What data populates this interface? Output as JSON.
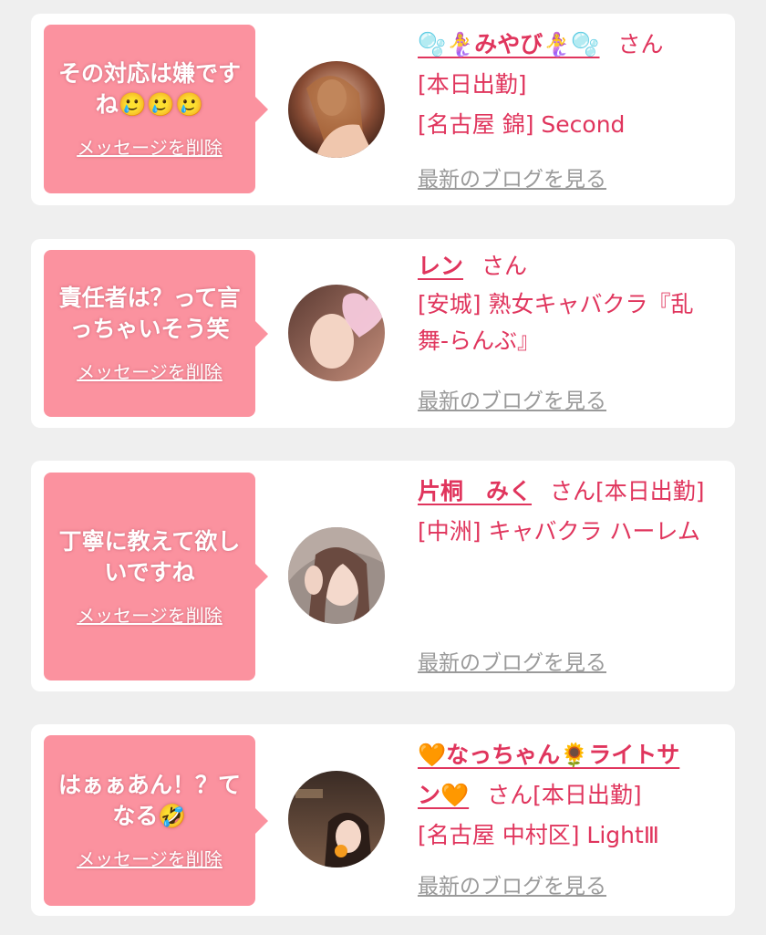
{
  "colors": {
    "page_background": "#efefef",
    "card_background": "#ffffff",
    "bubble": "#fb929f",
    "accent_text": "#e0355d",
    "link_gray": "#9a9a9a"
  },
  "cards": [
    {
      "message_lines": [
        "その対応は嫌です",
        "ね🥲🥲🥲"
      ],
      "delete_label": "メッセージを削除",
      "name_line1": "🫧🧜‍♀️みやび🧜‍♀️🫧",
      "name_line2": "",
      "honorific": "さん",
      "status": "[本日出勤]",
      "shop": "[名古屋 錦] Second",
      "blog_label": "最新のブログを見る",
      "avatar_icon": "profile-photo"
    },
    {
      "message_lines": [
        "責任者は？って言",
        "っちゃいそう笑"
      ],
      "delete_label": "メッセージを削除",
      "name_line1": "レン",
      "name_line2": "",
      "honorific": "さん",
      "status": "",
      "shop": "[安城] 熟女キャバクラ『乱舞-らんぶ』",
      "blog_label": "最新のブログを見る",
      "avatar_icon": "profile-photo"
    },
    {
      "message_lines": [
        "丁寧に教えて欲し",
        "いですね"
      ],
      "delete_label": "メッセージを削除",
      "name_line1": "片桐　みく",
      "name_line2": "",
      "honorific": "さん",
      "status": "[本日出勤]",
      "shop": "[中洲] キャバクラ ハーレム",
      "blog_label": "最新のブログを見る",
      "avatar_icon": "profile-photo"
    },
    {
      "message_lines": [
        "はぁぁあん！？て",
        "なる🤣"
      ],
      "delete_label": "メッセージを削除",
      "name_line1": "🧡なっちゃん🌻ライトサ",
      "name_line2": "ン🧡",
      "honorific": "さん",
      "status": "[本日出勤]",
      "shop": "[名古屋 中村区] LightⅢ",
      "blog_label": "最新のブログを見る",
      "avatar_icon": "profile-photo"
    }
  ]
}
